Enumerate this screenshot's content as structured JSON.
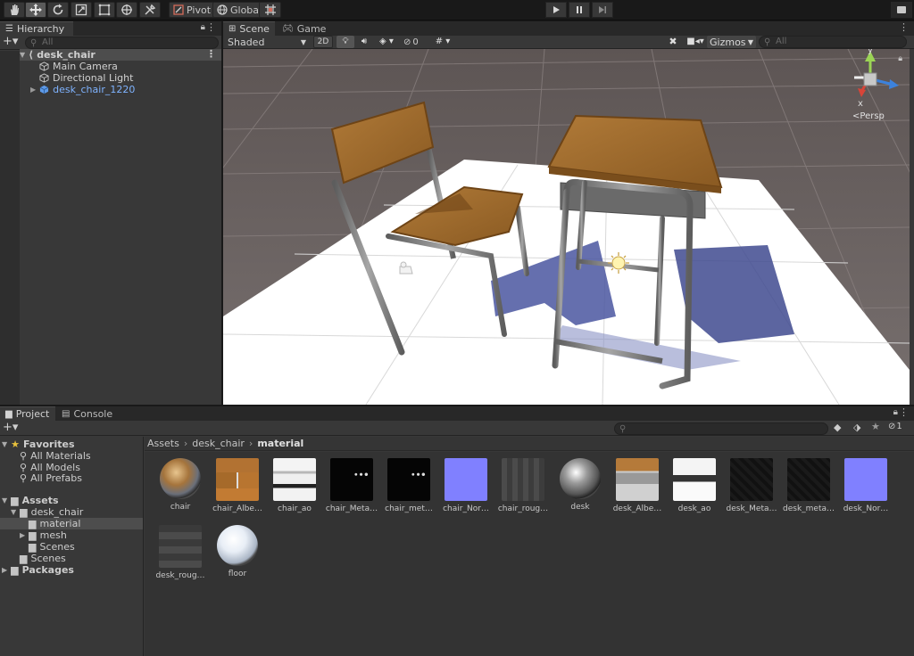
{
  "toolbar": {
    "tools": [
      "hand-icon",
      "move-icon",
      "rotate-icon",
      "scale-icon",
      "rect-icon",
      "transform-icon",
      "custom-tool-icon"
    ],
    "pivot_label": "Pivot",
    "global_label": "Global",
    "grid_snap_icon": "grid-snap-icon",
    "play_icons": [
      "play-icon",
      "pause-icon",
      "step-icon"
    ]
  },
  "hierarchy": {
    "tab_label": "Hierarchy",
    "search_placeholder": "All",
    "scene_name": "desk_chair",
    "items": [
      {
        "label": "Main Camera",
        "icon": "gameobject-icon"
      },
      {
        "label": "Directional Light",
        "icon": "gameobject-icon"
      },
      {
        "label": "desk_chair_1220",
        "icon": "prefab-icon"
      }
    ]
  },
  "scene": {
    "tabs": [
      {
        "label": "Scene",
        "icon": "grid-icon"
      },
      {
        "label": "Game",
        "icon": "gamepad-icon"
      }
    ],
    "shading_mode": "Shaded",
    "mode_2d": "2D",
    "hidden_count": "0",
    "gizmos_label": "Gizmos",
    "search_placeholder": "All",
    "view_label": "Persp",
    "axis_labels": {
      "y": "y",
      "x": "x"
    },
    "colors": {
      "grid": "#8a8181",
      "floor": "#ffffff",
      "shadow": "#3f4a8f",
      "wood": "#a3712f",
      "steel": "#7d7d7d"
    }
  },
  "project": {
    "tabs": [
      {
        "label": "Project",
        "icon": "folder-icon"
      },
      {
        "label": "Console",
        "icon": "console-icon"
      }
    ],
    "hidden_count": "1",
    "breadcrumb": [
      "Assets",
      "desk_chair",
      "material"
    ],
    "favorites": {
      "label": "Favorites",
      "items": [
        "All Materials",
        "All Models",
        "All Prefabs"
      ]
    },
    "assets_label": "Assets",
    "tree": [
      {
        "label": "desk_chair",
        "depth": 1,
        "expanded": true
      },
      {
        "label": "material",
        "depth": 2,
        "selected": true
      },
      {
        "label": "mesh",
        "depth": 2,
        "collapsed": true
      },
      {
        "label": "Scenes",
        "depth": 2
      },
      {
        "label": "Scenes",
        "depth": 1
      }
    ],
    "packages_label": "Packages",
    "assets": [
      {
        "label": "chair",
        "kind": "sphere-wood"
      },
      {
        "label": "chair_Albe…",
        "kind": "albedo"
      },
      {
        "label": "chair_ao",
        "kind": "ao"
      },
      {
        "label": "chair_Meta…",
        "kind": "dark-dots"
      },
      {
        "label": "chair_met…",
        "kind": "dark-dots"
      },
      {
        "label": "chair_Nor…",
        "kind": "normal"
      },
      {
        "label": "chair_roug…",
        "kind": "rough"
      },
      {
        "label": "desk",
        "kind": "sphere-metal"
      },
      {
        "label": "desk_Albe…",
        "kind": "albedo-desk"
      },
      {
        "label": "desk_ao",
        "kind": "ao-desk"
      },
      {
        "label": "desk_Meta…",
        "kind": "dark"
      },
      {
        "label": "desk_meta…",
        "kind": "dark"
      },
      {
        "label": "desk_Nor…",
        "kind": "normal"
      },
      {
        "label": "desk_roug…",
        "kind": "rough"
      },
      {
        "label": "floor",
        "kind": "sphere-white"
      }
    ]
  }
}
